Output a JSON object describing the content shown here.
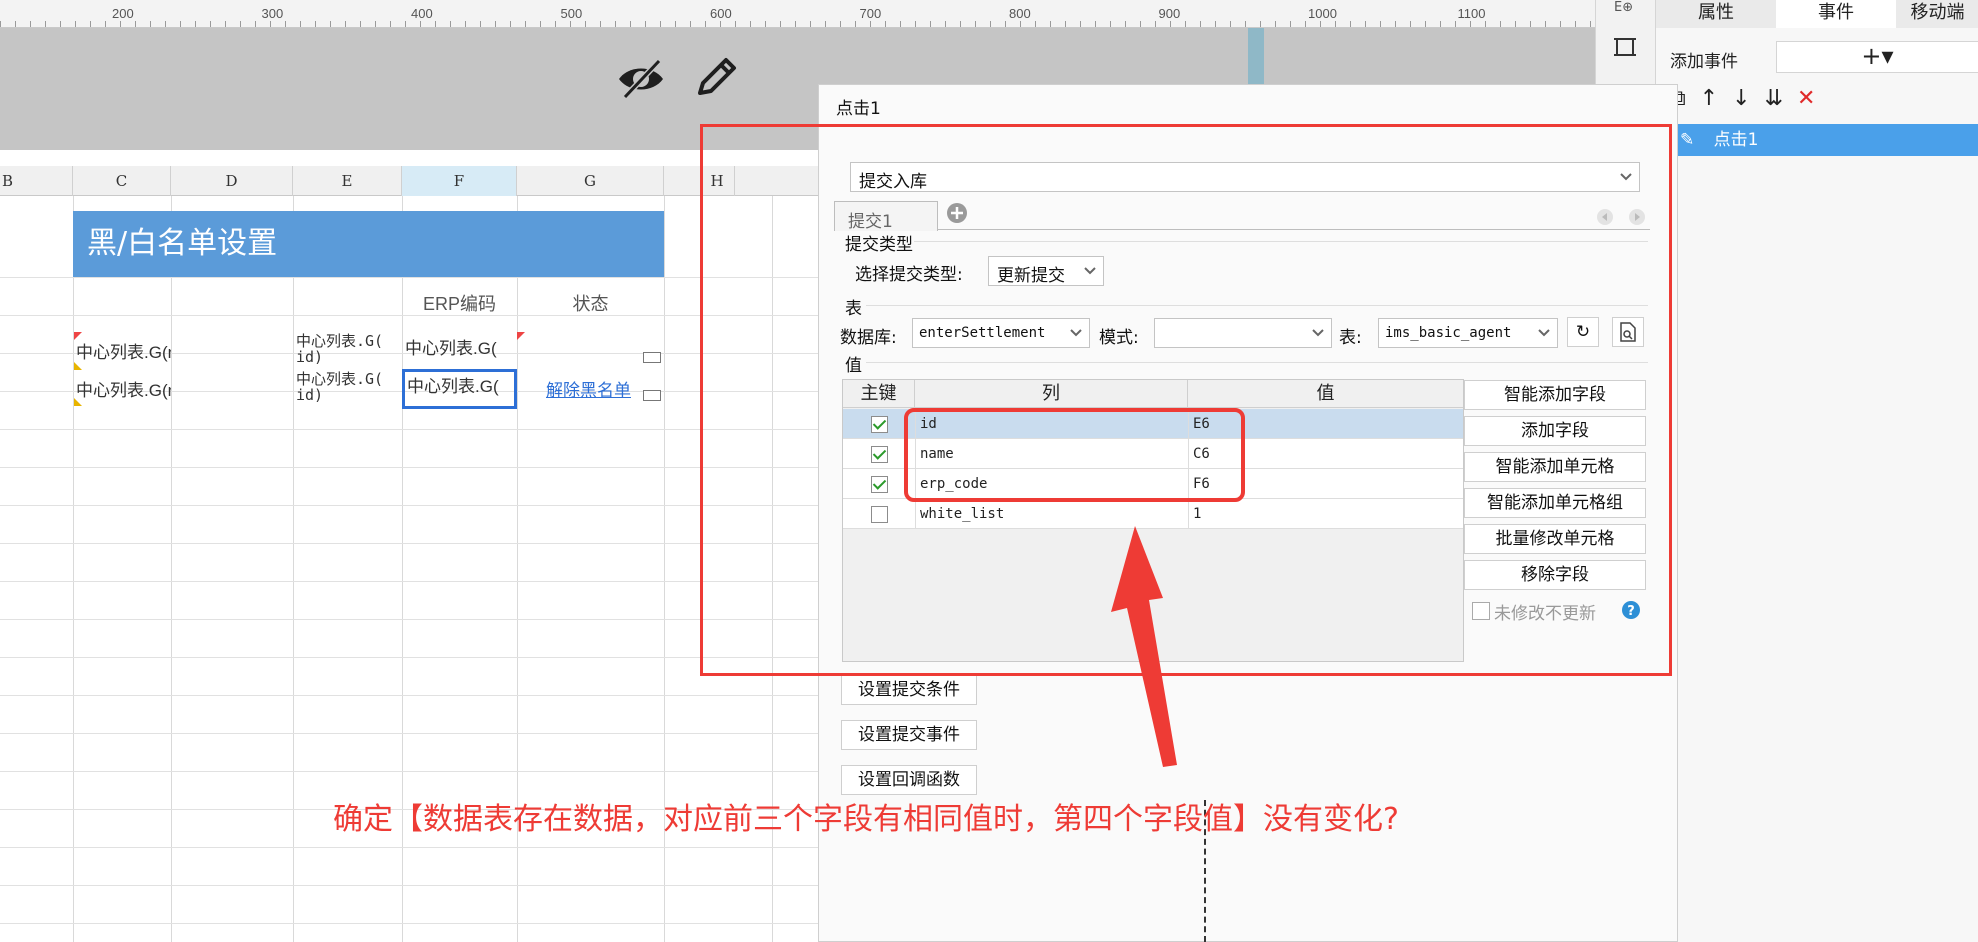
{
  "ruler": {
    "labels": [
      "200",
      "300",
      "400",
      "500",
      "600",
      "700",
      "800",
      "900",
      "1000",
      "1100"
    ]
  },
  "columns": [
    "B",
    "C",
    "D",
    "E",
    "F",
    "G",
    "H"
  ],
  "sheet": {
    "title": "黑/白名单设置",
    "header_erp": "ERP编码",
    "header_status": "状态",
    "row1": {
      "c": "中心列表.G(name)",
      "e": "中心列表.G(",
      "e2": "id)",
      "f": "中心列表.G("
    },
    "row2": {
      "c": "中心列表.G(name)",
      "e": "中心列表.G(",
      "e2": "id)",
      "f": "中心列表.G(",
      "g": "解除黑名单"
    }
  },
  "right_panel": {
    "tabs": [
      "属性",
      "事件",
      "移动端"
    ],
    "add_event_label": "添加事件",
    "event_item": "点击1"
  },
  "dialog": {
    "title": "点击1",
    "action_select": "提交入库",
    "submit_tab": "提交1",
    "submit_type_section": "提交类型",
    "select_type_label": "选择提交类型:",
    "select_type_value": "更新提交",
    "table_section": "表",
    "db_label": "数据库:",
    "db_value": "enterSettlement",
    "mode_label": "模式:",
    "mode_value": "",
    "table_label": "表:",
    "table_value": "ims_basic_agent",
    "value_section": "值",
    "columns": {
      "pk": "主键",
      "col": "列",
      "val": "值"
    },
    "rows": [
      {
        "checked": true,
        "col": "id",
        "val": "E6"
      },
      {
        "checked": true,
        "col": "name",
        "val": "C6"
      },
      {
        "checked": true,
        "col": "erp_code",
        "val": "F6"
      },
      {
        "checked": false,
        "col": "white_list",
        "val": "1"
      }
    ],
    "side_buttons": [
      "智能添加字段",
      "添加字段",
      "智能添加单元格",
      "智能添加单元格组",
      "批量修改单元格",
      "移除字段"
    ],
    "no_update_label": "未修改不更新",
    "bottom_buttons": [
      "设置提交条件",
      "设置提交事件",
      "设置回调函数"
    ]
  },
  "annotation": {
    "text": "确定【数据表存在数据，对应前三个字段有相同值时，第四个字段值】没有变化?",
    "color": "#ee3b35"
  },
  "colors": {
    "accent": "#5b9bd9",
    "selection": "#4aa0ea",
    "link": "#2d6fd6"
  }
}
